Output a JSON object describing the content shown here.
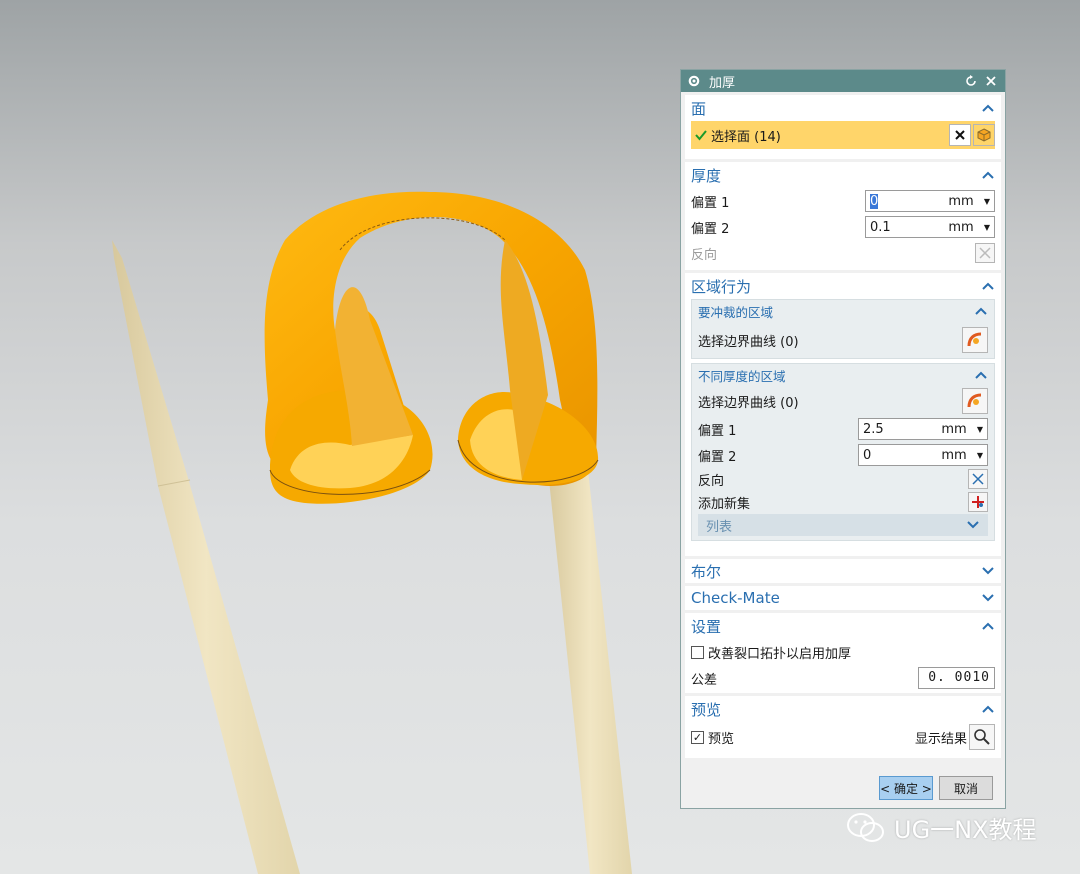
{
  "dialog": {
    "title": "加厚",
    "sections": {
      "face": {
        "label": "面",
        "select_text": "选择面 (14)"
      },
      "thickness": {
        "label": "厚度",
        "offset1": {
          "label": "偏置 1",
          "value": "0",
          "unit": "mm"
        },
        "offset2": {
          "label": "偏置 2",
          "value": "0.1",
          "unit": "mm"
        },
        "reverse_label": "反向"
      },
      "region": {
        "label": "区域行为",
        "punch": {
          "label": "要冲裁的区域",
          "select_label": "选择边界曲线 (0)"
        },
        "diff": {
          "label": "不同厚度的区域",
          "select_label": "选择边界曲线 (0)",
          "offset1": {
            "label": "偏置 1",
            "value": "2.5",
            "unit": "mm"
          },
          "offset2": {
            "label": "偏置 2",
            "value": "0",
            "unit": "mm"
          },
          "reverse_label": "反向",
          "add_set_label": "添加新集",
          "list_label": "列表"
        }
      },
      "bool": {
        "label": "布尔"
      },
      "checkmate": {
        "label": "Check-Mate"
      },
      "settings": {
        "label": "设置",
        "checkbox_label": "改善裂口拓扑以启用加厚",
        "tolerance_label": "公差",
        "tolerance_value": "0. 0010"
      },
      "preview": {
        "label": "预览",
        "checkbox_label": "预览",
        "show_result_label": "显示结果"
      }
    },
    "buttons": {
      "ok": "< 确定 >",
      "cancel": "取消"
    }
  },
  "watermark": {
    "text": "UG一NX教程"
  },
  "colors": {
    "title_bar": "#5c8a8a",
    "section_header": "#2a6fb0",
    "selected_face": "#ffd56a",
    "model_orange": "#f5a800",
    "rod": "#ecdfb6"
  }
}
